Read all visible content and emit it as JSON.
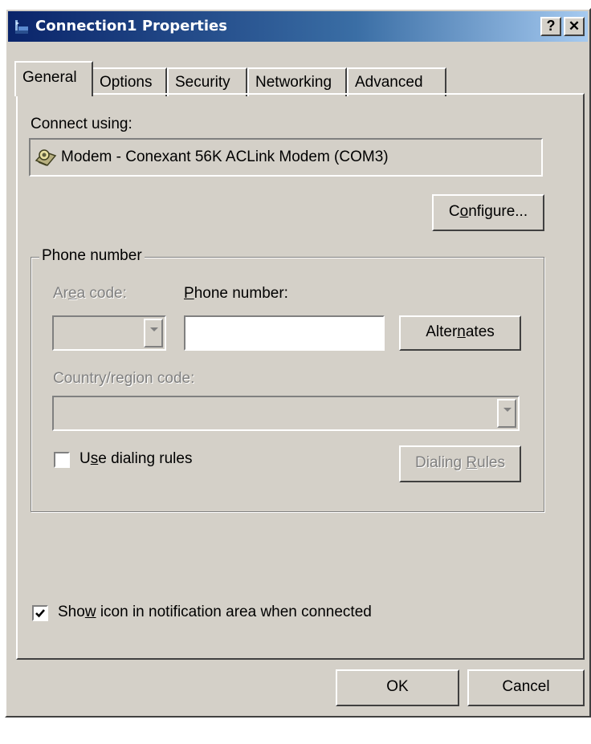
{
  "window": {
    "title": "Connection1 Properties",
    "help_button": "?",
    "close_button": "✕",
    "title_icon": "network-connection-icon"
  },
  "tabs": [
    {
      "label": "General",
      "active": true
    },
    {
      "label": "Options",
      "active": false
    },
    {
      "label": "Security",
      "active": false
    },
    {
      "label": "Networking",
      "active": false
    },
    {
      "label": "Advanced",
      "active": false
    }
  ],
  "general": {
    "connect_using_label": "Connect using:",
    "device_icon": "modem-icon",
    "device_name": "Modem - Conexant 56K ACLink Modem (COM3)",
    "configure_button": {
      "before": "C",
      "accel": "o",
      "after": "nfigure..."
    },
    "phone_group": {
      "title": "Phone number",
      "area_code_label": {
        "before": "Ar",
        "accel": "e",
        "after": "a code:"
      },
      "area_code_value": "",
      "phone_number_label": {
        "before": "",
        "accel": "P",
        "after": "hone number:"
      },
      "phone_number_value": "",
      "alternates_button": {
        "before": "Alter",
        "accel": "n",
        "after": "ates"
      },
      "country_label": "Country/region code:",
      "country_value": "",
      "use_dialing_rules": {
        "before": "U",
        "accel": "s",
        "after": "e dialing rules",
        "checked": false
      },
      "dialing_rules_button": {
        "before": "Dialing ",
        "accel": "R",
        "after": "ules"
      }
    },
    "show_icon": {
      "before": "Sho",
      "accel": "w",
      "after": " icon in notification area when connected",
      "checked": true
    }
  },
  "footer": {
    "ok": "OK",
    "cancel": "Cancel"
  }
}
